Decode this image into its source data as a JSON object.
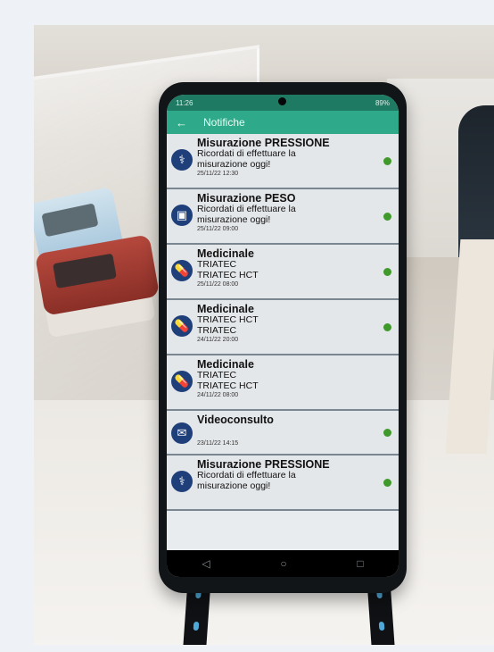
{
  "statusbar": {
    "time": "11:26",
    "battery": "89%"
  },
  "appbar": {
    "title": "Notifiche"
  },
  "notifications": [
    {
      "icon": "stethoscope-icon",
      "title": "Misurazione PRESSIONE",
      "lines": [
        "Ricordati di effettuare la",
        "misurazione oggi!"
      ],
      "date": "25/11/22 12:30",
      "unread": true
    },
    {
      "icon": "scale-icon",
      "title": "Misurazione PESO",
      "lines": [
        "Ricordati di effettuare la",
        "misurazione oggi!"
      ],
      "date": "25/11/22 09:00",
      "unread": true
    },
    {
      "icon": "pill-icon",
      "title": "Medicinale",
      "lines": [
        "TRIATEC",
        "TRIATEC HCT"
      ],
      "date": "25/11/22 08:00",
      "unread": true
    },
    {
      "icon": "pill-icon",
      "title": "Medicinale",
      "lines": [
        "TRIATEC HCT",
        "TRIATEC"
      ],
      "date": "24/11/22 20:00",
      "unread": true
    },
    {
      "icon": "pill-icon",
      "title": "Medicinale",
      "lines": [
        "TRIATEC",
        "TRIATEC HCT"
      ],
      "date": "24/11/22 08:00",
      "unread": false
    },
    {
      "icon": "mail-icon",
      "title": "Videoconsulto",
      "lines": [
        ""
      ],
      "date": "23/11/22 14:15",
      "unread": true
    },
    {
      "icon": "stethoscope-icon",
      "title": "Misurazione PRESSIONE",
      "lines": [
        "Ricordati di effettuare la",
        "misurazione oggi!"
      ],
      "date": "",
      "unread": true
    }
  ],
  "colors": {
    "appbar": "#2ea98a",
    "statusbar": "#1f7a64",
    "icon_bg": "#1e3f7a",
    "unread_dot": "#3f9a2b"
  }
}
